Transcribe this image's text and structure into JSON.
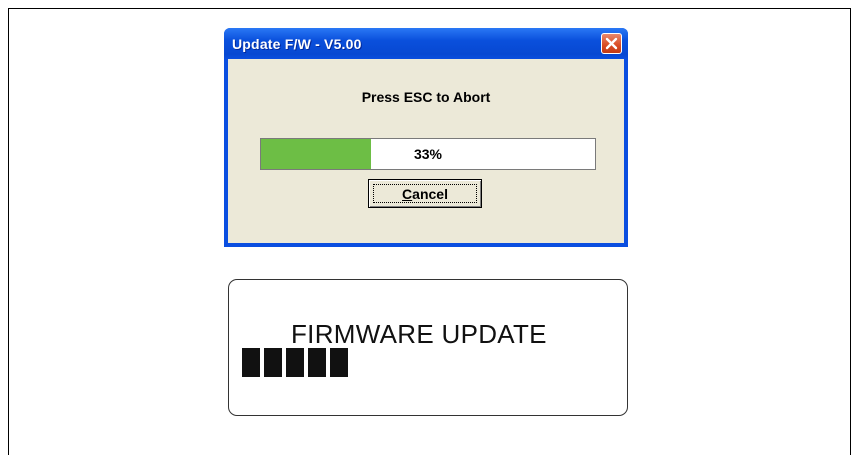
{
  "dialog": {
    "title": "Update F/W - V5.00",
    "message": "Press ESC to Abort",
    "progress": {
      "percent": 33,
      "label": "33%",
      "fill_color": "#6dbe45"
    },
    "cancel_label_underlined": "C",
    "cancel_label_rest": "ancel",
    "close_icon": "close-icon"
  },
  "lcd": {
    "text": "FIRMWARE UPDATE",
    "filled_blocks": 5
  },
  "colors": {
    "titlebar": "#0a4ee0",
    "window_bg": "#ece9d8",
    "close_button": "#d94b22"
  }
}
